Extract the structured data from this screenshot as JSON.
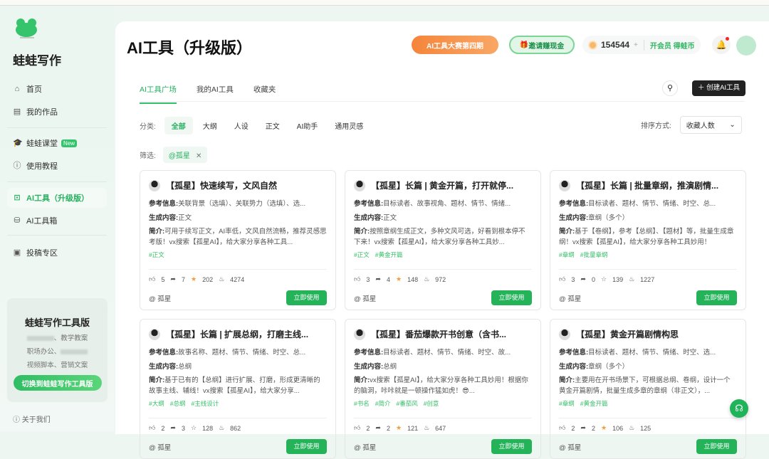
{
  "brand": "蛙蛙写作",
  "sidebar": {
    "items": [
      {
        "label": "首页",
        "icon": "home-icon",
        "glyph": "⌂"
      },
      {
        "label": "我的作品",
        "icon": "book-icon",
        "glyph": "▤"
      },
      {
        "label": "蛙蛙课堂",
        "icon": "graduation-cap-icon",
        "glyph": "🎓",
        "badge": "New"
      },
      {
        "label": "使用教程",
        "icon": "info-icon",
        "glyph": "ⓘ"
      },
      {
        "label": "AI工具（升级版）",
        "icon": "ai-tool-icon",
        "glyph": "⊡"
      },
      {
        "label": "AI工具箱",
        "icon": "toolbox-icon",
        "glyph": "⛁"
      },
      {
        "label": "投稿专区",
        "icon": "submit-icon",
        "glyph": "▣"
      }
    ],
    "promo": {
      "title": "蛙蛙写作工具版",
      "line1": "、教学教案",
      "line2": "职场办公、",
      "line3": "视频脚本、营销文案",
      "button": "切换到蛙蛙写作工具版"
    },
    "about": "关于我们"
  },
  "header": {
    "title": "AI工具（升级版）",
    "contest": "AI工具大赛第四期",
    "invite": "邀请赚现金",
    "coins": "154544",
    "plus": "+",
    "vip": "开会员 得蛙币"
  },
  "tabs": [
    "AI工具广场",
    "我的AI工具",
    "收藏夹"
  ],
  "create": "创建AI工具",
  "categories": {
    "label": "分类:",
    "items": [
      "全部",
      "大纲",
      "人设",
      "正文",
      "AI助手",
      "通用灵感"
    ]
  },
  "sort": {
    "label": "排序方式:",
    "value": "收藏人数"
  },
  "filter": {
    "label": "筛选:",
    "chip": "@孤星"
  },
  "card_labels": {
    "ref": "参考信息:",
    "gen": "生成内容:",
    "intro": "简介:",
    "use": "立即使用"
  },
  "cards": [
    {
      "title": "【孤星】快速续写，文风自然",
      "ref": "关联背景（选填）、关联势力（选填）、选...",
      "gen": "正文",
      "intro": "可用于续写正文，AI率低，文风自然流畅，推荐灵感思考版！vx搜索【孤星AI】，给大家分享各种工具...",
      "tags": [
        "#正文"
      ],
      "likes": "5",
      "shares": "7",
      "stars": "202",
      "uses": "4274",
      "starred": true,
      "author": "@ 孤星"
    },
    {
      "title": "【孤星】长篇 | 黄金开篇，打开就停...",
      "ref": "目标读者、故事视角、题材、情节、情绪...",
      "gen": "正文",
      "intro": "按照章纲生成正文，多种文风可选，好看到根本停不下来！vx搜索【孤星AI】，给大家分享各种工具妙...",
      "tags": [
        "#正文",
        "#黄金开篇"
      ],
      "likes": "3",
      "shares": "4",
      "stars": "148",
      "uses": "972",
      "starred": true,
      "author": "@ 孤星"
    },
    {
      "title": "【孤星】长篇 | 批量章纲，推演剧情...",
      "ref": "目标读者、题材、情节、情绪、时空、总...",
      "gen": "章纲（多个）",
      "intro": "基于【卷纲】，参考【总纲】、【题材】等，批量生成章纲！vx搜索【孤星AI】，给大家分享各种工具妙用！",
      "tags": [
        "#章纲",
        "#批量章纲"
      ],
      "likes": "3",
      "shares": "0",
      "stars": "139",
      "uses": "1227",
      "starred": false,
      "author": "@ 孤星"
    },
    {
      "title": "【孤星】长篇 | 扩展总纲，打磨主线...",
      "ref": "故事名称、题材、情节、情绪、时空、总...",
      "gen": "总纲",
      "intro": "基于已有的【总纲】进行扩展、打磨，形成更清晰的故事主线、辅线！vx搜索【孤星AI】，给大家分享...",
      "tags": [
        "#大纲",
        "#总纲",
        "#主线设计"
      ],
      "likes": "2",
      "shares": "3",
      "stars": "128",
      "uses": "862",
      "starred": false,
      "author": "@ 孤星"
    },
    {
      "title": "【孤星】番茄爆款开书创意（含书...",
      "ref": "目标读者、题材、情节、情绪、时空、故...",
      "gen": "总纲",
      "intro": "vx搜索【孤星AI】，给大家分享各种工具妙用！根据你的脑洞，咔咔就是一顿操作猛如虎！😎...",
      "tags": [
        "#书名",
        "#简介",
        "#番茄风",
        "#创意"
      ],
      "likes": "2",
      "shares": "2",
      "stars": "121",
      "uses": "647",
      "starred": true,
      "author": "@ 孤星"
    },
    {
      "title": "【孤星】黄金开篇剧情构思",
      "ref": "目标读者、题材、情节、情绪、时空、选...",
      "gen": "章纲（多个）",
      "intro": "主要用在开书场景下，可根据总纲、卷纲，设计一个黄金开篇剧情，批量生成多章的章纲（非正文），...",
      "tags": [
        "#章纲",
        "#黄金开篇"
      ],
      "likes": "2",
      "shares": "2",
      "stars": "106",
      "uses": "125",
      "starred": true,
      "author": "@ 孤星"
    }
  ]
}
